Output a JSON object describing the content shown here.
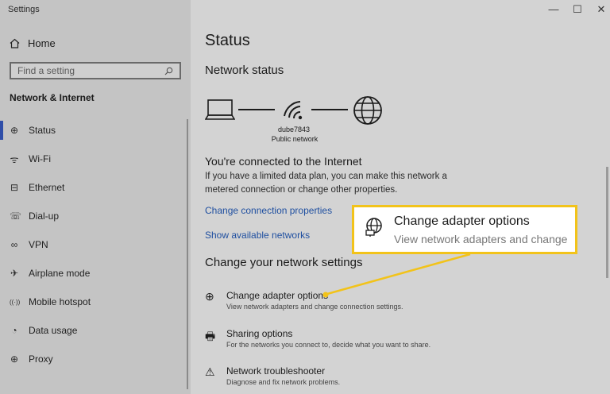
{
  "window": {
    "title": "Settings",
    "controls": [
      "—",
      "☐",
      "✕"
    ]
  },
  "sidebar": {
    "home_label": "Home",
    "search_placeholder": "Find a setting",
    "section": "Network & Internet",
    "items": [
      {
        "label": "Status",
        "icon": "globe-icon",
        "glyph": "⊕",
        "active": true
      },
      {
        "label": "Wi-Fi",
        "icon": "wifi-icon",
        "glyph": "ᯤ"
      },
      {
        "label": "Ethernet",
        "icon": "ethernet-icon",
        "glyph": "⊟"
      },
      {
        "label": "Dial-up",
        "icon": "dialup-icon",
        "glyph": "☏"
      },
      {
        "label": "VPN",
        "icon": "vpn-icon",
        "glyph": "∞"
      },
      {
        "label": "Airplane mode",
        "icon": "airplane-icon",
        "glyph": "✈"
      },
      {
        "label": "Mobile hotspot",
        "icon": "hotspot-icon",
        "glyph": "((·))"
      },
      {
        "label": "Data usage",
        "icon": "data-usage-icon",
        "glyph": "◔"
      },
      {
        "label": "Proxy",
        "icon": "proxy-icon",
        "glyph": "⊕"
      }
    ]
  },
  "main": {
    "title": "Status",
    "network_status_heading": "Network status",
    "network_name": "dube7843",
    "network_type": "Public network",
    "connected_heading": "You're connected to the Internet",
    "connected_desc": "If you have a limited data plan, you can make this network a metered connection or change other properties.",
    "link_change_properties": "Change connection properties",
    "link_show_networks": "Show available networks",
    "change_settings_heading": "Change your network settings",
    "options": [
      {
        "title": "Change adapter options",
        "desc": "View network adapters and change connection settings.",
        "icon": "adapter-icon",
        "glyph": "⊕"
      },
      {
        "title": "Sharing options",
        "desc": "For the networks you connect to, decide what you want to share.",
        "icon": "sharing-icon",
        "glyph": "🖶"
      },
      {
        "title": "Network troubleshooter",
        "desc": "Diagnose and fix network problems.",
        "icon": "warning-icon",
        "glyph": "⚠"
      }
    ]
  },
  "callout": {
    "title": "Change adapter options",
    "desc": "View network adapters and change",
    "accent": "#f2c31a"
  }
}
